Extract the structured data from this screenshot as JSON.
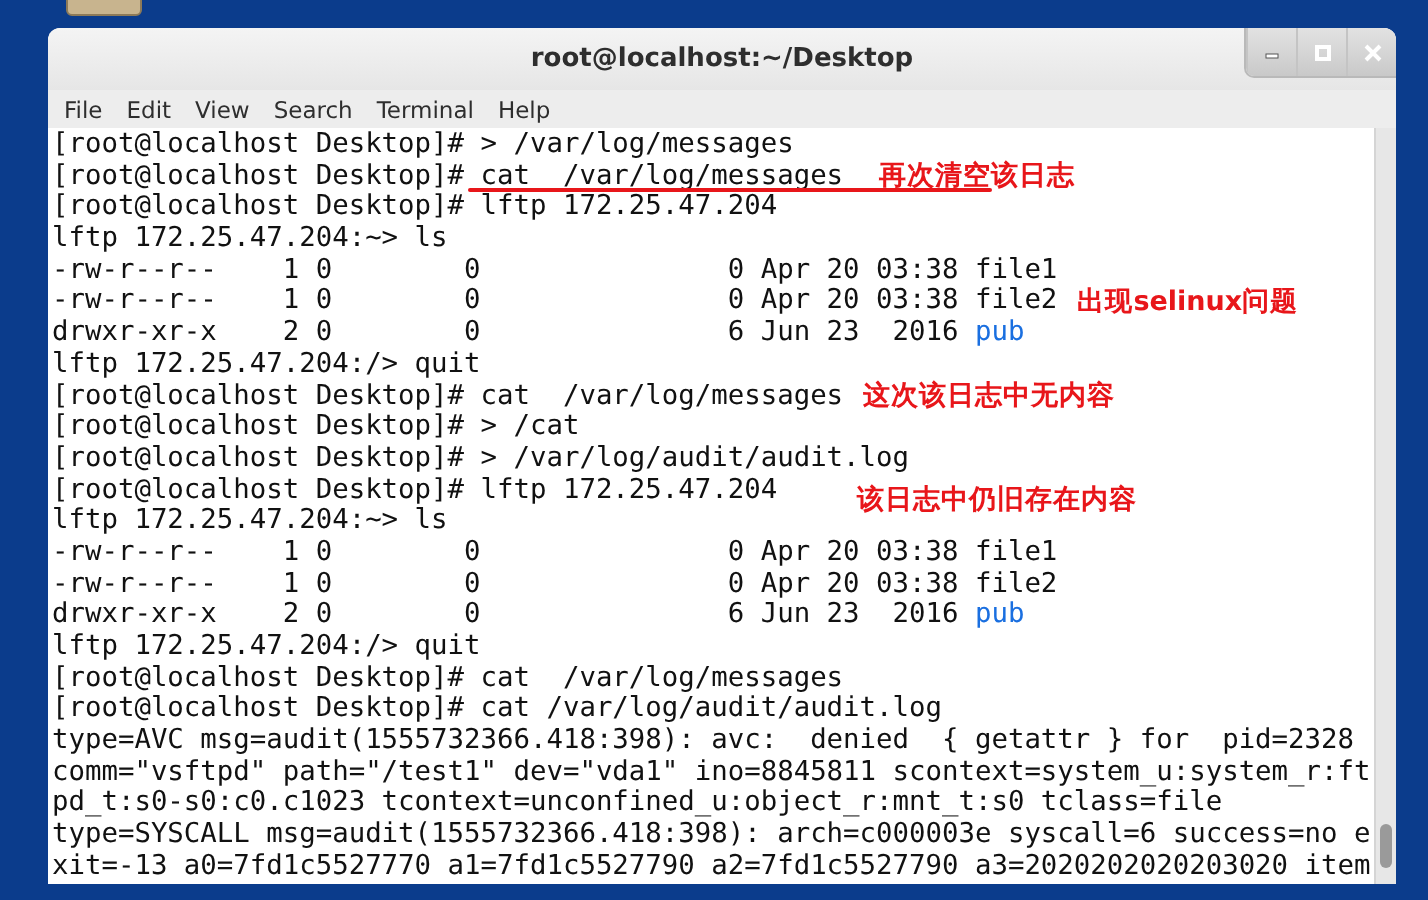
{
  "window": {
    "title": "root@localhost:~/Desktop"
  },
  "menu": [
    "File",
    "Edit",
    "View",
    "Search",
    "Terminal",
    "Help"
  ],
  "terminal": {
    "lines": [
      {
        "segments": [
          {
            "kind": "text",
            "text": "[root@localhost Desktop]# > /var/log/messages"
          }
        ]
      },
      {
        "segments": [
          {
            "kind": "text",
            "text": "[root@localhost Desktop]# cat  /var/log/messages"
          }
        ],
        "underlined": true,
        "note": "再次清空该日志"
      },
      {
        "segments": [
          {
            "kind": "text",
            "text": "[root@localhost Desktop]# lftp 172.25.47.204"
          }
        ]
      },
      {
        "segments": [
          {
            "kind": "text",
            "text": "lftp 172.25.47.204:~> ls"
          }
        ]
      },
      {
        "segments": [
          {
            "kind": "text",
            "text": "-rw-r--r--    1 0        0               0 Apr 20 03:38 file1"
          }
        ]
      },
      {
        "segments": [
          {
            "kind": "text",
            "text": "-rw-r--r--    1 0        0               0 Apr 20 03:38 file2"
          }
        ],
        "note": "出现selinux问题"
      },
      {
        "segments": [
          {
            "kind": "text",
            "text": "drwxr-xr-x    2 0        0               6 Jun 23  2016 "
          },
          {
            "kind": "directory",
            "text": "pub"
          }
        ]
      },
      {
        "segments": [
          {
            "kind": "text",
            "text": "lftp 172.25.47.204:/> quit"
          }
        ]
      },
      {
        "segments": [
          {
            "kind": "text",
            "text": "[root@localhost Desktop]# cat  /var/log/messages"
          }
        ],
        "note": "这次该日志中无内容"
      },
      {
        "segments": [
          {
            "kind": "text",
            "text": "[root@localhost Desktop]# > /cat"
          }
        ]
      },
      {
        "segments": [
          {
            "kind": "text",
            "text": "[root@localhost Desktop]# > /var/log/audit/audit.log"
          }
        ]
      },
      {
        "segments": [
          {
            "kind": "text",
            "text": "[root@localhost Desktop]# lftp 172.25.47.204"
          }
        ],
        "note": "该日志中仍旧存在内容"
      },
      {
        "segments": [
          {
            "kind": "text",
            "text": "lftp 172.25.47.204:~> ls"
          }
        ]
      },
      {
        "segments": [
          {
            "kind": "text",
            "text": "-rw-r--r--    1 0        0               0 Apr 20 03:38 file1"
          }
        ]
      },
      {
        "segments": [
          {
            "kind": "text",
            "text": "-rw-r--r--    1 0        0               0 Apr 20 03:38 file2"
          }
        ]
      },
      {
        "segments": [
          {
            "kind": "text",
            "text": "drwxr-xr-x    2 0        0               6 Jun 23  2016 "
          },
          {
            "kind": "directory",
            "text": "pub"
          }
        ]
      },
      {
        "segments": [
          {
            "kind": "text",
            "text": "lftp 172.25.47.204:/> quit"
          }
        ]
      },
      {
        "segments": [
          {
            "kind": "text",
            "text": "[root@localhost Desktop]# cat  /var/log/messages"
          }
        ]
      },
      {
        "segments": [
          {
            "kind": "text",
            "text": "[root@localhost Desktop]# cat /var/log/audit/audit.log"
          }
        ]
      },
      {
        "segments": [
          {
            "kind": "text",
            "text": "type=AVC msg=audit(1555732366.418:398): avc:  denied  { getattr } for  pid=2328"
          }
        ]
      },
      {
        "segments": [
          {
            "kind": "text",
            "text": "comm=\"vsftpd\" path=\"/test1\" dev=\"vda1\" ino=8845811 scontext=system_u:system_r:ft"
          }
        ]
      },
      {
        "segments": [
          {
            "kind": "text",
            "text": "pd_t:s0-s0:c0.c1023 tcontext=unconfined_u:object_r:mnt_t:s0 tclass=file"
          }
        ]
      },
      {
        "segments": [
          {
            "kind": "text",
            "text": "type=SYSCALL msg=audit(1555732366.418:398): arch=c000003e syscall=6 success=no e"
          }
        ]
      },
      {
        "segments": [
          {
            "kind": "text",
            "text": "xit=-13 a0=7fd1c5527770 a1=7fd1c5527790 a2=7fd1c5527790 a3=2020202020203020 item"
          }
        ]
      }
    ]
  }
}
